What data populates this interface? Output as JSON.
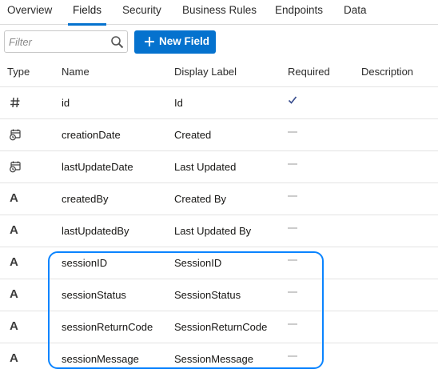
{
  "tabs": [
    {
      "label": "Overview"
    },
    {
      "label": "Fields",
      "active": true
    },
    {
      "label": "Security"
    },
    {
      "label": "Business Rules"
    },
    {
      "label": "Endpoints"
    },
    {
      "label": "Data"
    }
  ],
  "toolbar": {
    "filter_placeholder": "Filter",
    "new_field_label": "New Field"
  },
  "table": {
    "headers": {
      "type": "Type",
      "name": "Name",
      "display_label": "Display Label",
      "required": "Required",
      "description": "Description"
    },
    "rows": [
      {
        "type_icon": "number-icon",
        "name": "id",
        "display_label": "Id",
        "required": "check"
      },
      {
        "type_icon": "datetime-icon",
        "name": "creationDate",
        "display_label": "Created",
        "required": "dash"
      },
      {
        "type_icon": "datetime-icon",
        "name": "lastUpdateDate",
        "display_label": "Last Updated",
        "required": "dash"
      },
      {
        "type_icon": "text-icon",
        "name": "createdBy",
        "display_label": "Created By",
        "required": "dash"
      },
      {
        "type_icon": "text-icon",
        "name": "lastUpdatedBy",
        "display_label": "Last Updated By",
        "required": "dash"
      },
      {
        "type_icon": "text-icon",
        "name": "sessionID",
        "display_label": "SessionID",
        "required": "dash"
      },
      {
        "type_icon": "text-icon",
        "name": "sessionStatus",
        "display_label": "SessionStatus",
        "required": "dash"
      },
      {
        "type_icon": "text-icon",
        "name": "sessionReturnCode",
        "display_label": "SessionReturnCode",
        "required": "dash"
      },
      {
        "type_icon": "text-icon",
        "name": "sessionMessage",
        "display_label": "SessionMessage",
        "required": "dash"
      }
    ]
  },
  "text_icon_glyph": "A",
  "colors": {
    "accent": "#0572ce",
    "highlight": "#0a84ff",
    "check": "#3b4f8f"
  }
}
